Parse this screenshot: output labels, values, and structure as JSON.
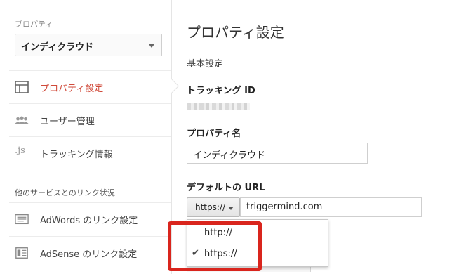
{
  "sidebar": {
    "caption": "プロパティ",
    "property_select": "インディクラウド",
    "items": [
      {
        "label": "プロパティ設定",
        "icon": "layout-icon",
        "active": true
      },
      {
        "label": "ユーザー管理",
        "icon": "users-icon",
        "active": false
      },
      {
        "label": "トラッキング情報",
        "icon": "js-icon",
        "active": false
      }
    ],
    "section_title": "他のサービスとのリンク状況",
    "links": [
      {
        "label": "AdWords のリンク設定",
        "icon": "adwords-icon"
      },
      {
        "label": "AdSense のリンク設定",
        "icon": "adsense-icon"
      }
    ],
    "js_text": ".js"
  },
  "main": {
    "title": "プロパティ設定",
    "section": "基本設定",
    "tracking_id_label": "トラッキング ID",
    "property_name_label": "プロパティ名",
    "property_name_value": "インディクラウド",
    "default_url_label": "デフォルトの URL",
    "protocol_selected": "https://",
    "url_value": "triggermind.com",
    "protocol_options": [
      "http://",
      "https://"
    ],
    "check_mark": "✔"
  },
  "colors": {
    "active": "#d04a3a",
    "highlight_border": "#d9251d"
  }
}
